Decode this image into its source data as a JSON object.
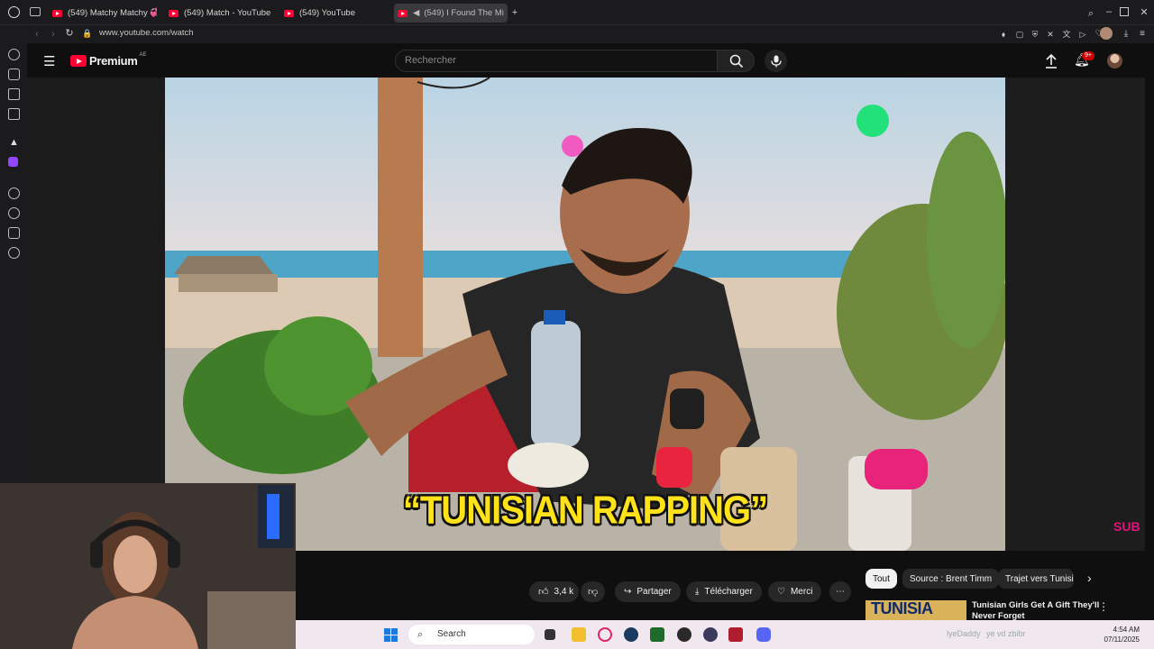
{
  "browser": {
    "tabs": [
      {
        "label": "(549) Matchy Matchy 💞"
      },
      {
        "label": "(549) Match - YouTube"
      },
      {
        "label": "(549) YouTube"
      },
      {
        "label": "(549) I Found The Mi"
      }
    ],
    "new_tab": "+",
    "url": "www.youtube.com/watch"
  },
  "youtube": {
    "logo": "Premium",
    "country_code": "AE",
    "search_placeholder": "Rechercher",
    "notification_badge": "9+"
  },
  "video": {
    "caption": "“TUNISIAN RAPPING”",
    "channel_watermark": "SUB"
  },
  "actions": {
    "likes": "3,4 k",
    "share": "Partager",
    "download": "Télécharger",
    "thanks": "Merci"
  },
  "chips": [
    {
      "label": "Tout",
      "active": true
    },
    {
      "label": "Source : Brent Timm",
      "active": false
    },
    {
      "label": "Trajet vers Tunisie",
      "active": false
    }
  ],
  "recommended": {
    "thumbnail_text": "TUNISIA",
    "title": "Tunisian Girls Get A Gift They'll Never Forget"
  },
  "taskbar": {
    "search": "Search",
    "overlay_text": "lyeDaddy",
    "overlay_text2": "ye vd zbibr",
    "time": "4:54 AM",
    "date": "07/11/2025"
  },
  "colors": {
    "yt_red": "#ff0033",
    "caption_yellow": "#ffe21a",
    "background": "#0f0f0f"
  }
}
